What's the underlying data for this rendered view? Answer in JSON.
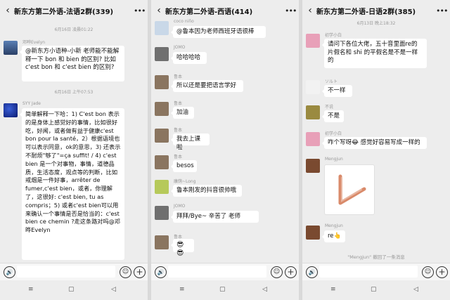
{
  "panel1": {
    "title": "新东方第二外语-法语2群(339)",
    "time1": "6月16日 凌晨01:22",
    "m1_user": "邓晔Evelyn",
    "m1_text": "@新东方小语种-小新  老师能不能解释一下 bon 和 bien 的区别? 比如 c'est bon 和 c'est bien 的区别?",
    "time2": "6月16日 上午07:53",
    "m2_user": "SYY Jade",
    "m2_text": "简单解释一下哈：1) C'est bon 表示的是身体上感觉好的事情，比如很好吃，好闻，或者做有益于健康c'est bon pour la santé，2）根据语境也可以表示同意，ok的意思，3) 还表示不耐烦\"够了\"=ça suffit! / 4) c'est bien 是一个对事物，事情，道德品质，生活态度，观点等的判断，比如戒烟是一件好事，arrêter de fumer,c'est bien，或者，你理解了，这很好: c'est bien, tu as compris；5) 或者c'est bien可以用来确认一个事情是否是恰当的：c'est bien ce chemin ?走这条路对吗@邓晔Evelyn"
  },
  "panel2": {
    "title": "新东方第二外语-西语(414)",
    "msgs": [
      {
        "user": "coco niño",
        "text": "@鲁本因为老师西班牙语很棒"
      },
      {
        "user": "JOMO",
        "text": "哈哈哈哈"
      },
      {
        "user": "鲁本",
        "text": "所以还是要把语言学好"
      },
      {
        "user": "鲁本",
        "text": "加油"
      },
      {
        "user": "鲁本",
        "text": "我去上课啦"
      },
      {
        "user": "鲁本",
        "text": "besos"
      },
      {
        "user": "康荫~Long",
        "text": "鲁本刚发的抖音很帅哦"
      },
      {
        "user": "JOMO",
        "text": "拜拜/Bye~ 辛苦了 老师"
      },
      {
        "user": "鲁本",
        "text": "😎😎"
      }
    ]
  },
  "panel3": {
    "title": "新东方第二外语-日语2群(385)",
    "time1": "6月13日 晚上18:32",
    "msgs": [
      {
        "user": "初学小白",
        "text": "请问下各位大佬，五十音里面re的片假名和 shi 的平假名是不是一样的"
      },
      {
        "user": "ソルト",
        "text": "不一样"
      },
      {
        "user": "不说",
        "text": "不是"
      },
      {
        "user": "初学小白",
        "text": "咋个写呀😂 感觉好容易写成一样的"
      },
      {
        "user": "Mengjun",
        "text": ""
      },
      {
        "user": "Mengjun",
        "text": "re👆"
      }
    ],
    "notice": "\"Mengjun\" 撤回了一条消息"
  },
  "icons": {
    "back": "‹",
    "more": "•••",
    "voice": "🔊",
    "emoji": "☺",
    "plus": "+",
    "nav_menu": "≡",
    "nav_home": "▢",
    "nav_back": "◁"
  }
}
